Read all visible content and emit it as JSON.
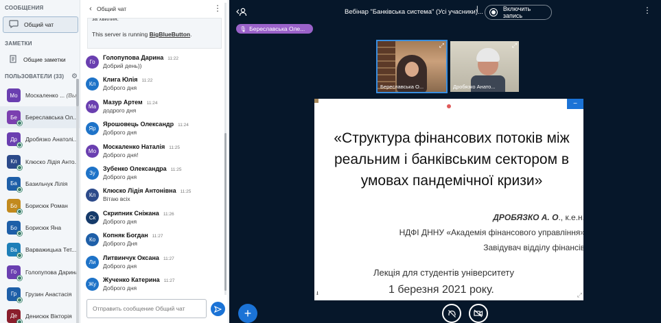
{
  "sidebar": {
    "messages_title": "СООБЩЕНИЯ",
    "public_chat_label": "Общий чат",
    "notes_title": "ЗАМЕТКИ",
    "shared_notes_label": "Общие заметки",
    "users_title": "ПОЛЬЗОВАТЕЛИ (33)",
    "users": [
      {
        "initials": "Мо",
        "name": "Москаленко ...",
        "you": "(Вы)",
        "color": "#6a3fb0"
      },
      {
        "initials": "Бе",
        "name": "Береславська Ол...",
        "color": "#7b3fb0"
      },
      {
        "initials": "Др",
        "name": "Дробязко Анатолі...",
        "color": "#6a3fb0"
      },
      {
        "initials": "Кл",
        "name": "Клюско Лідія Анто...",
        "color": "#2c4a8a"
      },
      {
        "initials": "Ба",
        "name": "Базильчук Лілія",
        "color": "#1e5fa8"
      },
      {
        "initials": "Бо",
        "name": "Борисюк Роман",
        "color": "#c28a1e"
      },
      {
        "initials": "Бо",
        "name": "Борисюк Яна",
        "color": "#1e5fa8"
      },
      {
        "initials": "Ва",
        "name": "Варважицька Тет...",
        "color": "#1e7fb8"
      },
      {
        "initials": "Го",
        "name": "Голопупова Дарина",
        "color": "#6a3fb0"
      },
      {
        "initials": "Гр",
        "name": "Грузин Анастасія",
        "color": "#1e5fa8"
      },
      {
        "initials": "Де",
        "name": "Денисюк Вікторія",
        "color": "#8a1e2c"
      }
    ]
  },
  "chat": {
    "title": "Общий чат",
    "welcome_cut": "за хвилин.",
    "server_prefix": "This server is running ",
    "server_name": "BigBlueButton",
    "server_suffix": ".",
    "input_placeholder": "Отправить сообщение Общий чат",
    "messages": [
      {
        "initials": "Го",
        "color": "#6a3fb0",
        "name": "Голопупова Дарина",
        "time": "11:22",
        "text": "Добрий день))"
      },
      {
        "initials": "Кл",
        "color": "#1e73c8",
        "name": "Клига Юлія",
        "time": "11:22",
        "text": "Доброго дня"
      },
      {
        "initials": "Ма",
        "color": "#6a3fb0",
        "name": "Мазур Артем",
        "time": "11:24",
        "text": "додрого дня"
      },
      {
        "initials": "Яр",
        "color": "#1e73c8",
        "name": "Ярошовець Олександр",
        "time": "11:24",
        "text": "Доброго дня"
      },
      {
        "initials": "Мо",
        "color": "#6a3fb0",
        "name": "Москаленко Наталія",
        "time": "11:25",
        "text": "Доброго дня!"
      },
      {
        "initials": "Зу",
        "color": "#1e73c8",
        "name": "Зубенко Олександра",
        "time": "11:25",
        "text": "Доброго дня"
      },
      {
        "initials": "Кл",
        "color": "#2c4a8a",
        "name": "Клюско Лідія Антонівна",
        "time": "11:25",
        "text": "Вітаю всіх"
      },
      {
        "initials": "Ск",
        "color": "#153a6a",
        "name": "Скрипник Сніжана",
        "time": "11:26",
        "text": "Доброго дня"
      },
      {
        "initials": "Ко",
        "color": "#1e5fa8",
        "name": "Копняк Богдан",
        "time": "11:27",
        "text": "Доброго Дня"
      },
      {
        "initials": "Ли",
        "color": "#1e73c8",
        "name": "Литвинчук Оксана",
        "time": "11:27",
        "text": "Доброго дня"
      },
      {
        "initials": "Жу",
        "color": "#1e73c8",
        "name": "Жученко Катерина",
        "time": "11:27",
        "text": "Доброго дня"
      }
    ]
  },
  "main": {
    "meeting_title": "Вебінар \"Банківська система\" (Усі учасники)...",
    "record_label": "Включить запись",
    "talker_name": "Береславська Оле...",
    "videos": [
      {
        "name": "Береславська О..."
      },
      {
        "name": "Дробязко Анато..."
      }
    ],
    "slide": {
      "title_lines": [
        "«Структура фінансових потоків між",
        "реальним і банківським сектором в",
        "умовах пандемічної кризи»"
      ],
      "author": "ДРОБЯЗКО А. О",
      "author_suffix": "., к.е.н.",
      "org": "НДФІ ДННУ «Академія фінансового управління»",
      "position": "Завідувач відділу фінансів",
      "lecture": "Лекція для студентів університету",
      "date": "1 березня 2021 року."
    }
  }
}
